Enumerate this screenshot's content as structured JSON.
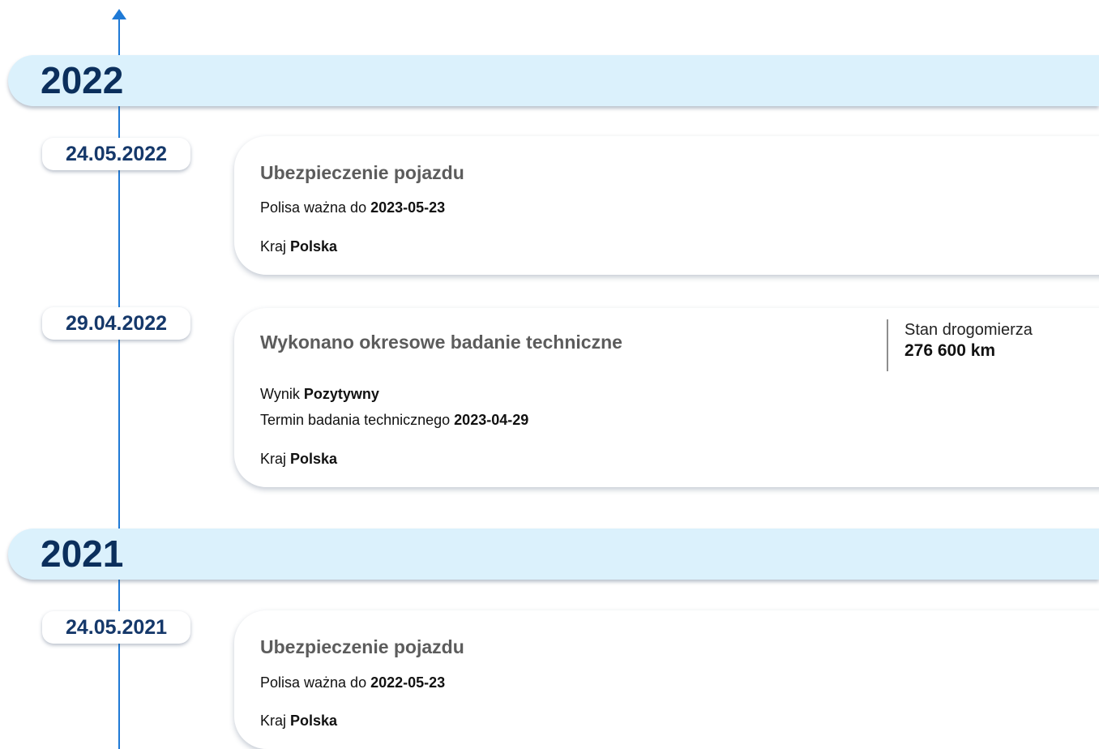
{
  "timeline": {
    "years": [
      {
        "year": "2022",
        "events": [
          {
            "date": "24.05.2022",
            "title": "Ubezpieczenie pojazdu",
            "policy_label": "Polisa ważna do",
            "policy_value": "2023-05-23",
            "country_label": "Kraj",
            "country_value": "Polska"
          },
          {
            "date": "29.04.2022",
            "title": "Wykonano okresowe badanie techniczne",
            "odometer_label": "Stan drogomierza",
            "odometer_value": "276 600 km",
            "result_label": "Wynik",
            "result_value": "Pozytywny",
            "term_label": "Termin badania technicznego",
            "term_value": "2023-04-29",
            "country_label": "Kraj",
            "country_value": "Polska"
          }
        ]
      },
      {
        "year": "2021",
        "events": [
          {
            "date": "24.05.2021",
            "title": "Ubezpieczenie pojazdu",
            "policy_label": "Polisa ważna do",
            "policy_value": "2022-05-23",
            "country_label": "Kraj",
            "country_value": "Polska"
          }
        ]
      }
    ]
  },
  "colors": {
    "accent": "#1f7ad6",
    "year_band": "#dbf1fc",
    "year_text": "#0b2f5c",
    "date_text": "#15386a",
    "card_title": "#5c5c5c"
  }
}
